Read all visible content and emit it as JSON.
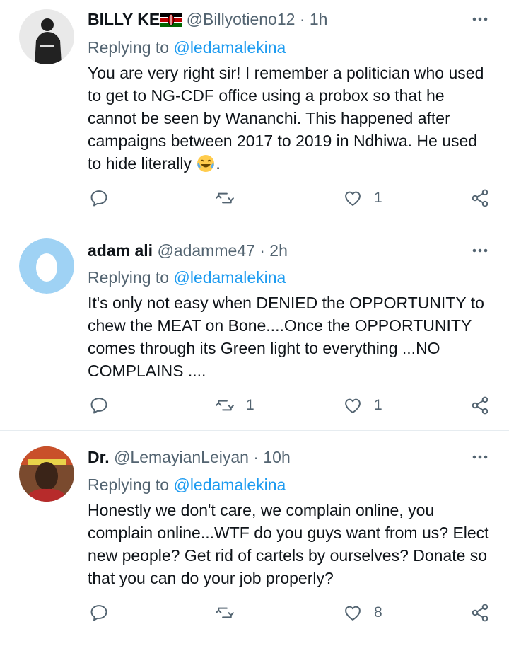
{
  "tweets": [
    {
      "display_name": "BILLY KE",
      "handle": "@Billyotieno12",
      "time": "· 1h",
      "replying_prefix": "Replying to",
      "replying_to": "@ledamalekina",
      "text": "You are very right sir! I remember a politician who used to get to NG-CDF office using a probox so that he cannot be seen by Wananchi. This happened after campaigns between 2017 to 2019 in Ndhiwa. He used to hide literally",
      "text_suffix": ".",
      "retweets": "",
      "likes": "1"
    },
    {
      "display_name": "adam ali",
      "handle": "@adamme47",
      "time": "· 2h",
      "replying_prefix": "Replying to",
      "replying_to": "@ledamalekina",
      "text": "It's only not easy when DENIED the OPPORTUNITY to chew the MEAT on Bone....Once the OPPORTUNITY comes through its Green light to everything ...NO COMPLAINS ....",
      "text_suffix": "",
      "retweets": "1",
      "likes": "1"
    },
    {
      "display_name": "Dr.",
      "handle": "@LemayianLeiyan",
      "time": "· 10h",
      "replying_prefix": "Replying to",
      "replying_to": "@ledamalekina",
      "text": "Honestly we don't care, we complain online, you complain online...WTF do you guys want from us? Elect new people? Get rid of cartels by ourselves? Donate so that you can do your job properly?",
      "text_suffix": "",
      "retweets": "",
      "likes": "8"
    }
  ],
  "colors": {
    "text": "#0f1419",
    "secondary": "#536471",
    "link": "#1d9bf0",
    "divider": "#e6ecf0"
  },
  "icons": [
    "more-icon",
    "reply-icon",
    "retweet-icon",
    "like-icon",
    "share-icon",
    "kenya-flag-icon",
    "laughing-emoji-icon"
  ]
}
